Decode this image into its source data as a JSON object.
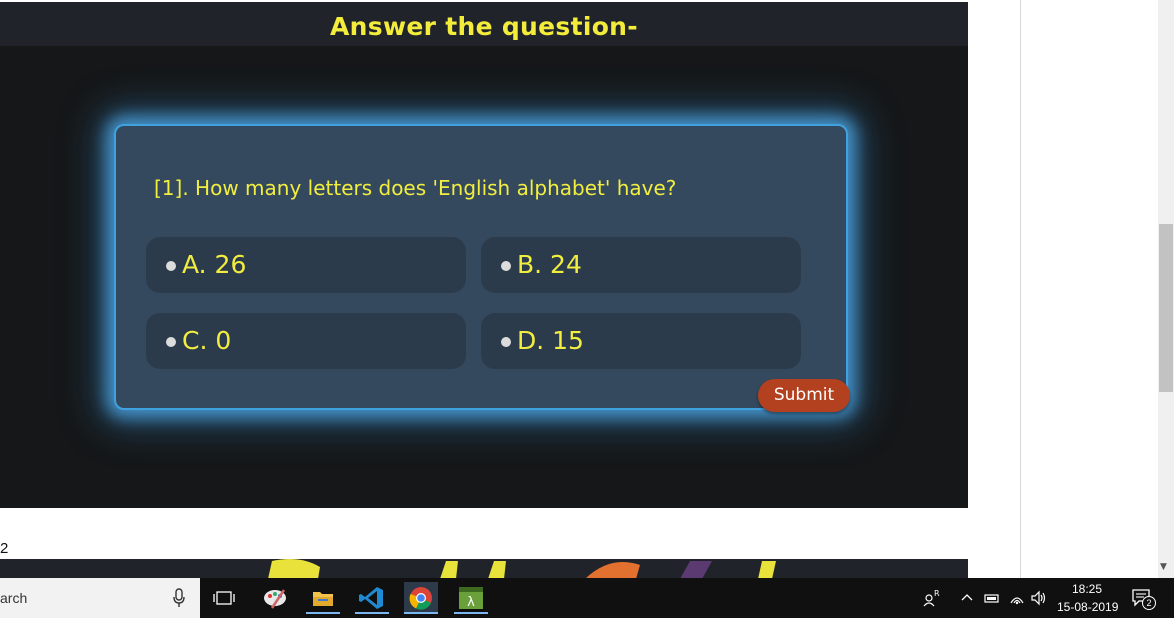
{
  "quiz": {
    "title": "Answer the question-",
    "question": "[1]. How many letters does 'English alphabet' have?",
    "options": [
      {
        "label": "A. 26"
      },
      {
        "label": "B. 24"
      },
      {
        "label": "C. 0"
      },
      {
        "label": "D. 15"
      }
    ],
    "submit_label": "Submit"
  },
  "page": {
    "number_label": "2"
  },
  "taskbar": {
    "search_text": "arch",
    "pinned": [
      "paint-icon",
      "file-explorer-icon",
      "vscode-icon",
      "chrome-icon",
      "terminal-icon"
    ],
    "time": "18:25",
    "date": "15-08-2019",
    "notification_count": "2"
  },
  "colors": {
    "quiz_title": "#f4ec3a",
    "card_bg": "#34495e",
    "card_glow": "#3ea2df",
    "option_bg": "#2b3b4b",
    "submit_bg": "#b3401f"
  }
}
